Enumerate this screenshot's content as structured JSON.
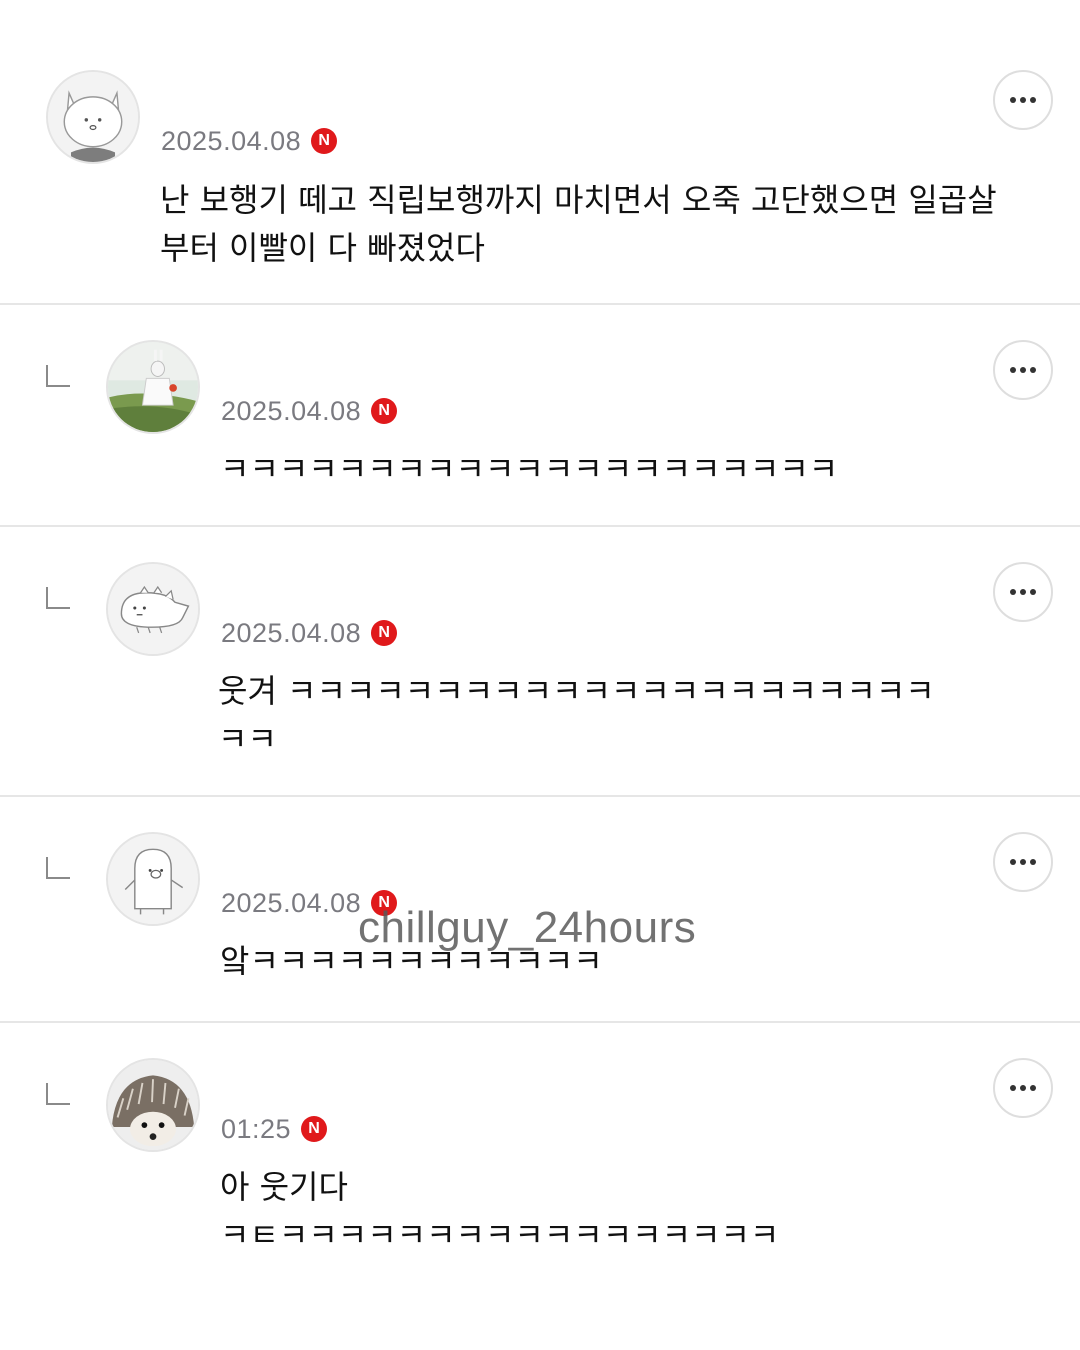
{
  "comments": [
    {
      "avatar": "cat-character-avatar",
      "date": "2025.04.08",
      "badge": "N",
      "text": "난 보행기 떼고 직립보행까지 마치면서 오죽 고단했으면 일곱살\n부터 이빨이 다 빠졌었다",
      "is_reply": false
    },
    {
      "avatar": "person-in-field-avatar",
      "date": "2025.04.08",
      "badge": "N",
      "text": "ㅋㅋㅋㅋㅋㅋㅋㅋㅋㅋㅋㅋㅋㅋㅋㅋㅋㅋㅋㅋㅋ",
      "is_reply": true
    },
    {
      "avatar": "dinosaur-character-avatar",
      "date": "2025.04.08",
      "badge": "N",
      "text": "웃겨 ㅋㅋㅋㅋㅋㅋㅋㅋㅋㅋㅋㅋㅋㅋㅋㅋㅋㅋㅋㅋㅋㅋ\nㅋㅋ",
      "is_reply": true
    },
    {
      "avatar": "ghost-pig-character-avatar",
      "date": "2025.04.08",
      "badge": "N",
      "text": "앜ㅋㅋㅋㅋㅋㅋㅋㅋㅋㅋㅋㅋ",
      "is_reply": true
    },
    {
      "avatar": "hedgehog-avatar",
      "date": "01:25",
      "badge": "N",
      "text": "아 웃기다\nㅋㅌㅋㅋㅋㅋㅋㅋㅋㅋㅋㅋㅋㅋㅋㅋㅋㅋㅋ",
      "is_reply": true
    }
  ],
  "watermark": "chillguy_24hours"
}
